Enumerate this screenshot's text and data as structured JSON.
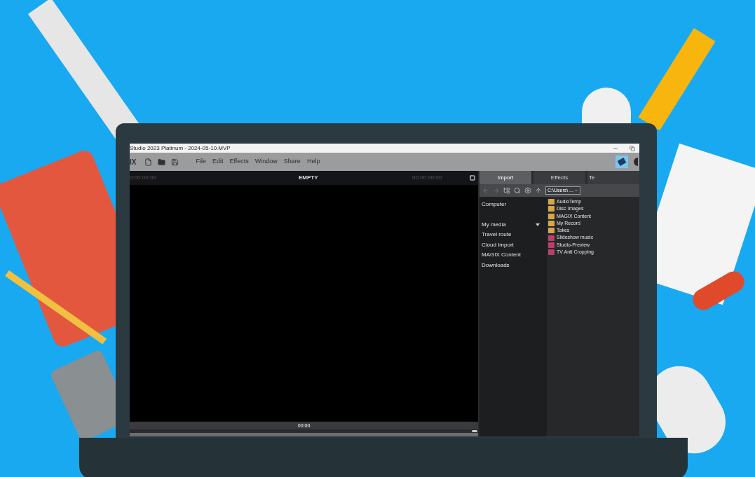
{
  "window": {
    "title": "Studio 2023 Platinum - 2024-05-10.MVP"
  },
  "toolbar": {
    "logo": "IX",
    "menu": [
      "File",
      "Edit",
      "Effects",
      "Window",
      "Share",
      "Help"
    ]
  },
  "preview": {
    "timecode_left": "0:00:00:00",
    "title": "EMPTY",
    "timecode_right": "00:00:00:00",
    "position": "00:00"
  },
  "tabs": [
    {
      "label": "Import",
      "selected": true
    },
    {
      "label": "Effects",
      "selected": false
    },
    {
      "label": "Te",
      "selected": false
    }
  ],
  "path": "C:\\Users\\ ...",
  "sidebar": {
    "items": [
      {
        "label": "Computer",
        "has_menu": false
      },
      {
        "label": "My media",
        "has_menu": true
      },
      {
        "label": "Travel route",
        "has_menu": false
      },
      {
        "label": "Cloud Import",
        "has_menu": false
      },
      {
        "label": "MAGIX Content",
        "has_menu": false
      },
      {
        "label": "Downloads",
        "has_menu": false
      }
    ]
  },
  "files": [
    {
      "name": "AudioTemp",
      "kind": "folder"
    },
    {
      "name": "Disc Images",
      "kind": "folder"
    },
    {
      "name": "MAGIX Content",
      "kind": "folder"
    },
    {
      "name": "My Record",
      "kind": "folder"
    },
    {
      "name": "Takes",
      "kind": "folder"
    },
    {
      "name": "Slideshow music",
      "kind": "special"
    },
    {
      "name": "Studio-Preview",
      "kind": "special"
    },
    {
      "name": "TV Anti Cropping",
      "kind": "special"
    }
  ]
}
